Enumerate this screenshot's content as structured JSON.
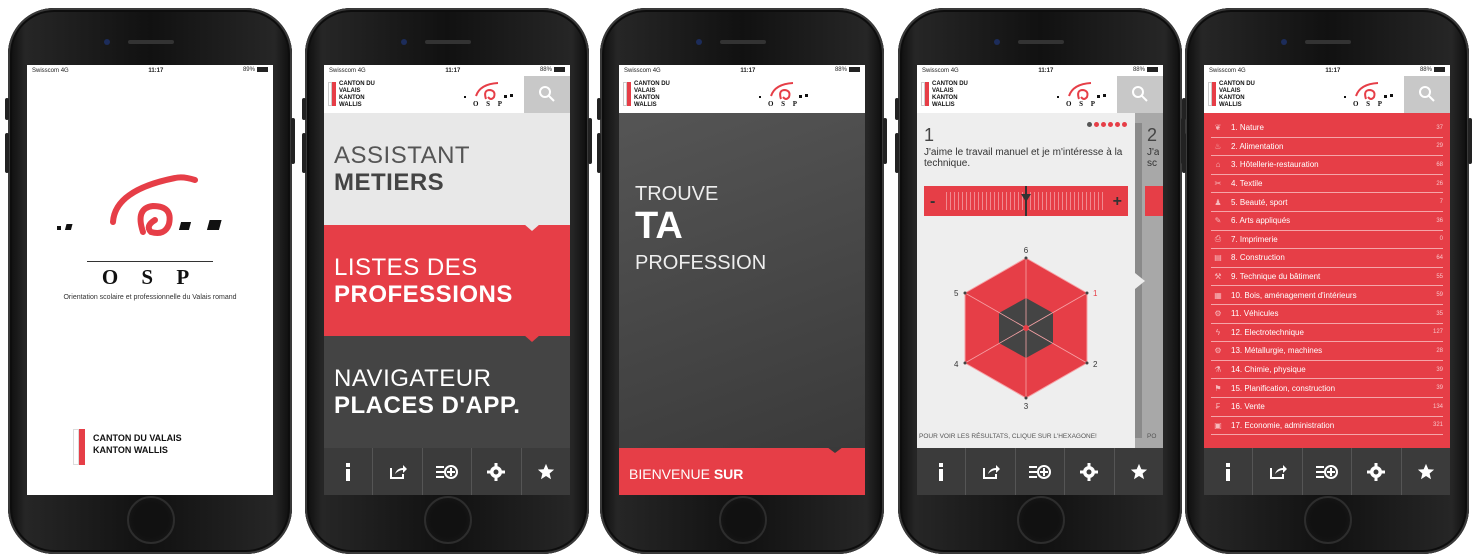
{
  "status": {
    "carrier": "Swisscom",
    "network": "4G",
    "time": "11:17",
    "battery_p1": "89%",
    "battery": "88%"
  },
  "brand": {
    "osp": "O S P",
    "osp_subtitle": "Orientation scolaire et professionnelle du Valais romand",
    "canton_line1": "CANTON DU VALAIS",
    "canton_line2": "KANTON WALLIS",
    "red": "#e63e47",
    "dark": "#3b3b3b"
  },
  "icons": [
    "info-icon",
    "share-icon",
    "list-add-icon",
    "gear-icon",
    "star-icon",
    "search-icon"
  ],
  "menu": [
    {
      "line1": "ASSISTANT",
      "line2": "METIERS"
    },
    {
      "line1": "LISTES DES",
      "line2": "PROFESSIONS"
    },
    {
      "line1": "NAVIGATEUR",
      "line2": "PLACES D'APP."
    }
  ],
  "welcome": {
    "line1": "TROUVE",
    "line2": "TA",
    "line3": "PROFESSION",
    "bottom_prefix": "BIENVENUE ",
    "bottom_bold": "SUR"
  },
  "quiz": {
    "number": "1",
    "next_number": "2",
    "question": "J'aime le travail manuel et je m'intéresse à la technique.",
    "next_question": "J'a sc",
    "minus": "-",
    "plus": "+",
    "footer": "POUR VOIR LES RÉSULTATS, CLIQUE SUR L'HEXAGONE!",
    "next_footer": "PO",
    "axis_labels": [
      "6",
      "1",
      "2",
      "3",
      "4",
      "5"
    ],
    "progress_dots": 6,
    "progress_current": 1
  },
  "categories": [
    {
      "label": "1. Nature",
      "count": "37"
    },
    {
      "label": "2. Alimentation",
      "count": "29"
    },
    {
      "label": "3. Hôtellerie-restauration",
      "count": "68"
    },
    {
      "label": "4. Textile",
      "count": "26"
    },
    {
      "label": "5. Beauté, sport",
      "count": "7"
    },
    {
      "label": "6. Arts appliqués",
      "count": "36"
    },
    {
      "label": "7. Imprimerie",
      "count": "0"
    },
    {
      "label": "8. Construction",
      "count": "64"
    },
    {
      "label": "9. Technique du bâtiment",
      "count": "55"
    },
    {
      "label": "10. Bois, aménagement d'intérieurs",
      "count": "59"
    },
    {
      "label": "11. Véhicules",
      "count": "35"
    },
    {
      "label": "12. Electrotechnique",
      "count": "127"
    },
    {
      "label": "13. Métallurgie, machines",
      "count": "28"
    },
    {
      "label": "14. Chimie, physique",
      "count": "39"
    },
    {
      "label": "15. Planification, construction",
      "count": "39"
    },
    {
      "label": "16. Vente",
      "count": "134"
    },
    {
      "label": "17. Economie, administration",
      "count": "321"
    }
  ]
}
